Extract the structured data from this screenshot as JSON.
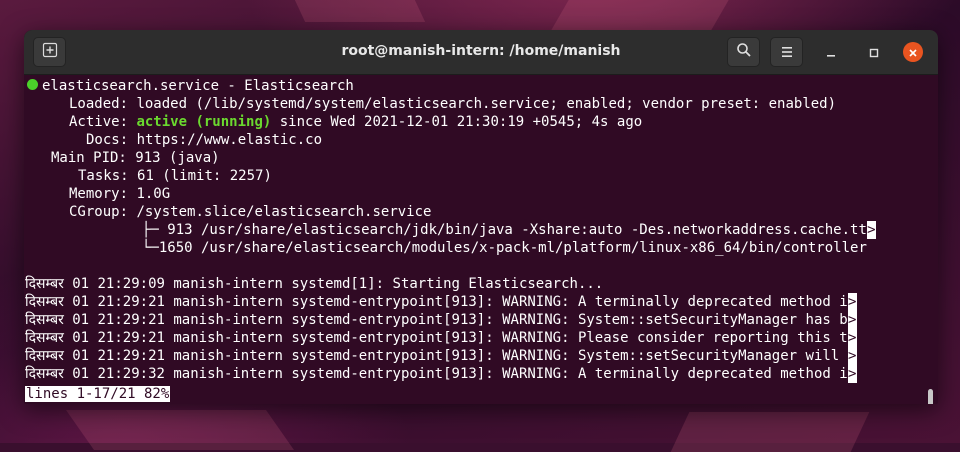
{
  "window": {
    "title": "root@manish-intern: /home/manish",
    "icons": {
      "new_tab": "new-tab-icon",
      "search": "search-icon",
      "menu": "hamburger-menu-icon",
      "minimize": "minimize-icon",
      "maximize": "maximize-icon",
      "close": "close-icon"
    },
    "colors": {
      "terminal_bg": "#300a24",
      "close": "#e95420",
      "active_dot": "#4bd12a"
    }
  },
  "service": {
    "header": "elasticsearch.service - Elasticsearch",
    "loaded_label": "Loaded:",
    "loaded_value": "loaded (/lib/systemd/system/elasticsearch.service; enabled; vendor preset: enabled)",
    "active_label": "Active:",
    "active_state": "active (running)",
    "active_since": " since Wed 2021-12-01 21:30:19 +0545; 4s ago",
    "docs_label": "Docs:",
    "docs_value": "https://www.elastic.co",
    "pid_label": "Main PID:",
    "pid_value": "913 (java)",
    "tasks_label": "Tasks:",
    "tasks_value": "61 (limit: 2257)",
    "memory_label": "Memory:",
    "memory_value": "1.0G",
    "cgroup_label": "CGroup:",
    "cgroup_value": "/system.slice/elasticsearch.service",
    "cgroup_child1": "├─ 913 /usr/share/elasticsearch/jdk/bin/java -Xshare:auto -Des.networkaddress.cache.tt",
    "cgroup_child2": "└─1650 /usr/share/elasticsearch/modules/x-pack-ml/platform/linux-x86_64/bin/controller"
  },
  "logs": [
    "दिसम्बर 01 21:29:09 manish-intern systemd[1]: Starting Elasticsearch...",
    "दिसम्बर 01 21:29:21 manish-intern systemd-entrypoint[913]: WARNING: A terminally deprecated method i",
    "दिसम्बर 01 21:29:21 manish-intern systemd-entrypoint[913]: WARNING: System::setSecurityManager has b",
    "दिसम्बर 01 21:29:21 manish-intern systemd-entrypoint[913]: WARNING: Please consider reporting this t",
    "दिसम्बर 01 21:29:21 manish-intern systemd-entrypoint[913]: WARNING: System::setSecurityManager will ",
    "दिसम्बर 01 21:29:32 manish-intern systemd-entrypoint[913]: WARNING: A terminally deprecated method i"
  ],
  "truncation_marker": ">",
  "pager_status": "lines 1-17/21 82%"
}
